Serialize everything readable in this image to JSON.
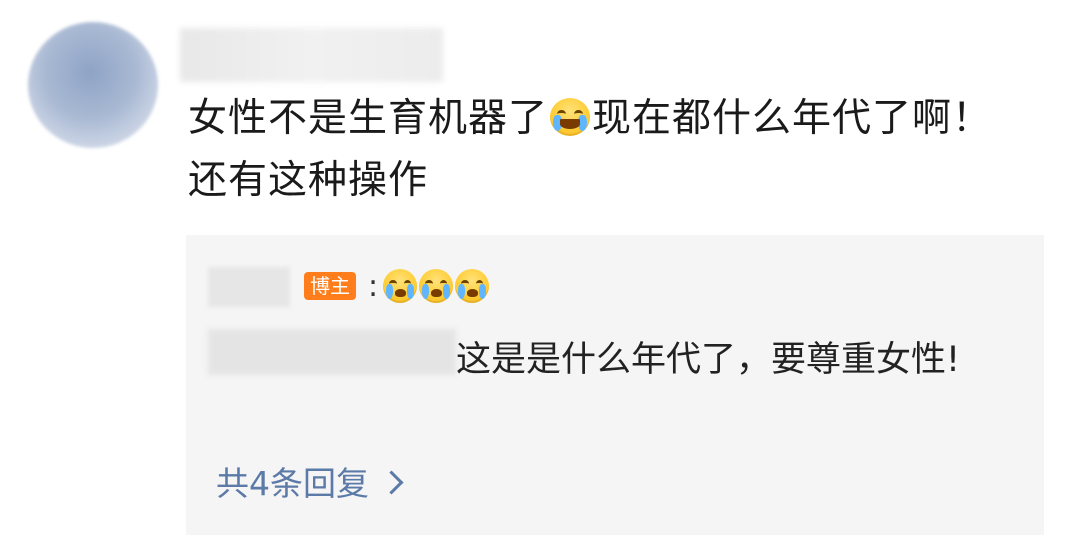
{
  "comment": {
    "text_part1": "女性不是生育机器了",
    "emoji": "laugh-cry-emoji",
    "text_part2": "现在都什么年代了啊！还有这种操作"
  },
  "reply": {
    "author_badge": "博主",
    "colon": ":",
    "emojis": [
      "crying-emoji",
      "crying-emoji",
      "crying-emoji"
    ],
    "text": "这是是什么年代了，要尊重女性!",
    "more_replies": "共4条回复"
  },
  "colors": {
    "badge": "#ff7d1a",
    "link": "#5b7aa8",
    "reply_bg": "#f5f5f5"
  }
}
